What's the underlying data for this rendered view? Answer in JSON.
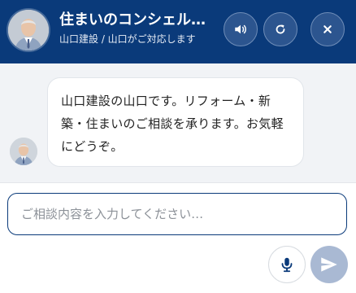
{
  "header": {
    "title": "住まいのコンシェル…",
    "subtitle": "山口建設 / 山口がご対応します",
    "sound_icon": "speaker-icon",
    "refresh_icon": "refresh-icon",
    "close_icon": "close-icon"
  },
  "chat": {
    "messages": [
      {
        "sender": "agent",
        "text": "山口建設の山口です。リフォーム・新築・住まいのご相談を承ります。お気軽にどうぞ。"
      }
    ]
  },
  "composer": {
    "placeholder": "ご相談内容を入力してください…",
    "value": "",
    "mic_icon": "microphone-icon",
    "send_icon": "send-icon"
  },
  "colors": {
    "header_bg": "#0a3a7a",
    "chat_bg": "#f1f3f6",
    "send_disabled": "#a9b9d3"
  }
}
